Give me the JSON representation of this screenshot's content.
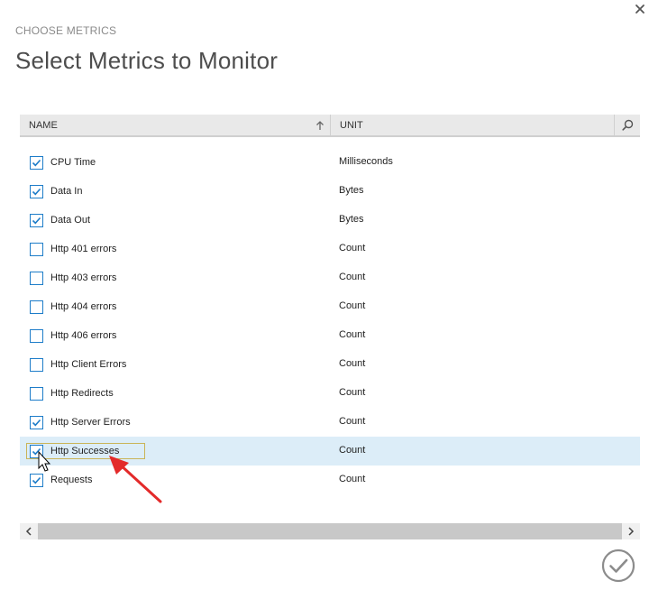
{
  "dialog": {
    "subtitle": "CHOOSE METRICS",
    "title": "Select Metrics to Monitor"
  },
  "grid": {
    "columns": {
      "name": "NAME",
      "unit": "UNIT"
    },
    "rows": [
      {
        "name": "CPU Time",
        "unit": "Milliseconds",
        "checked": true
      },
      {
        "name": "Data In",
        "unit": "Bytes",
        "checked": true
      },
      {
        "name": "Data Out",
        "unit": "Bytes",
        "checked": true
      },
      {
        "name": "Http 401 errors",
        "unit": "Count",
        "checked": false
      },
      {
        "name": "Http 403 errors",
        "unit": "Count",
        "checked": false
      },
      {
        "name": "Http 404 errors",
        "unit": "Count",
        "checked": false
      },
      {
        "name": "Http 406 errors",
        "unit": "Count",
        "checked": false
      },
      {
        "name": "Http Client Errors",
        "unit": "Count",
        "checked": false
      },
      {
        "name": "Http Redirects",
        "unit": "Count",
        "checked": false
      },
      {
        "name": "Http Server Errors",
        "unit": "Count",
        "checked": true
      },
      {
        "name": "Http Successes",
        "unit": "Count",
        "checked": true,
        "selected": true
      },
      {
        "name": "Requests",
        "unit": "Count",
        "checked": true
      }
    ]
  },
  "icons": {
    "close": "close-icon",
    "sort": "sort-ascending-icon",
    "search": "search-icon",
    "checkmark": "checkmark-icon",
    "confirm": "confirm-check-icon",
    "scroll_left": "chevron-left-icon",
    "scroll_right": "chevron-right-icon"
  },
  "colors": {
    "accent": "#1e7dc9",
    "selected_row": "#dcedf8",
    "header_bg": "#e9e9e9",
    "annotation_arrow": "#e32a2a"
  }
}
